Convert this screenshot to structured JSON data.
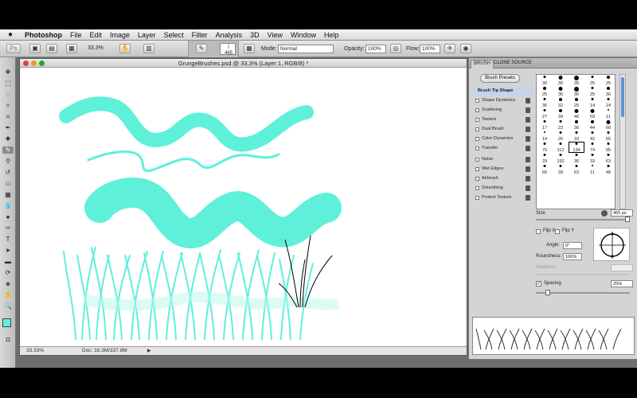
{
  "menubar": {
    "items": [
      "Photoshop",
      "File",
      "Edit",
      "Image",
      "Layer",
      "Select",
      "Filter",
      "Analysis",
      "3D",
      "View",
      "Window",
      "Help"
    ]
  },
  "optbar": {
    "zoom": "33.3%",
    "brush_size": "465",
    "mode_label": "Mode:",
    "mode_value": "Normal",
    "opacity_label": "Opacity:",
    "opacity_value": "100%",
    "flow_label": "Flow:",
    "flow_value": "100%"
  },
  "document": {
    "title": "GrungeBrushes.psd @ 33.3% (Layer 1, RGB/8) *",
    "status_zoom": "33.33%",
    "status_doc": "Doc: 16.3M/337.8M",
    "stroke_color": "#5ff0da"
  },
  "panel": {
    "tabs": [
      "BRUSH",
      "CLONE SOURCE"
    ],
    "preset_button": "Brush Presets",
    "options": [
      {
        "label": "Brush Tip Shape",
        "active": true
      },
      {
        "label": "Shape Dynamics"
      },
      {
        "label": "Scattering"
      },
      {
        "label": "Texture"
      },
      {
        "label": "Dual Brush"
      },
      {
        "label": "Color Dynamics"
      },
      {
        "label": "Transfer"
      },
      {
        "label": "Noise"
      },
      {
        "label": "Wet Edges"
      },
      {
        "label": "Airbrush"
      },
      {
        "label": "Smoothing"
      },
      {
        "label": "Protect Texture"
      }
    ],
    "tips": [
      {
        "n": "30",
        "s": 3
      },
      {
        "n": "30",
        "s": 5
      },
      {
        "n": "30",
        "s": 6
      },
      {
        "n": "25",
        "s": 3
      },
      {
        "n": "25",
        "s": 4
      },
      {
        "n": "25",
        "s": 4
      },
      {
        "n": "36",
        "s": 5
      },
      {
        "n": "36",
        "s": 6
      },
      {
        "n": "25",
        "s": 3
      },
      {
        "n": "36",
        "s": 4
      },
      {
        "n": "36",
        "s": 3
      },
      {
        "n": "32",
        "s": 4
      },
      {
        "n": "25",
        "s": 4
      },
      {
        "n": "14",
        "s": 3
      },
      {
        "n": "24",
        "s": 3
      },
      {
        "n": "27",
        "s": 3
      },
      {
        "n": "39",
        "s": 4
      },
      {
        "n": "46",
        "s": 5
      },
      {
        "n": "59",
        "s": 5
      },
      {
        "n": "11",
        "s": 2
      },
      {
        "n": "17",
        "s": 3
      },
      {
        "n": "23",
        "s": 3
      },
      {
        "n": "36",
        "s": 4
      },
      {
        "n": "44",
        "s": 4
      },
      {
        "n": "60",
        "s": 5
      },
      {
        "n": "14",
        "s": 2
      },
      {
        "n": "26",
        "s": 3
      },
      {
        "n": "33",
        "s": 3
      },
      {
        "n": "42",
        "s": 3
      },
      {
        "n": "55",
        "s": 3
      },
      {
        "n": "70",
        "s": 3
      },
      {
        "n": "112",
        "s": 3
      },
      {
        "n": "134",
        "s": 3
      },
      {
        "n": "74",
        "s": 3
      },
      {
        "n": "95",
        "s": 3
      },
      {
        "n": "29",
        "s": 3
      },
      {
        "n": "192",
        "s": 3
      },
      {
        "n": "36",
        "s": 3
      },
      {
        "n": "33",
        "s": 3
      },
      {
        "n": "63",
        "s": 3
      },
      {
        "n": "66",
        "s": 3
      },
      {
        "n": "39",
        "s": 3
      },
      {
        "n": "63",
        "s": 3
      },
      {
        "n": "11",
        "s": 2
      },
      {
        "n": "48",
        "s": 3
      }
    ],
    "size_label": "Size",
    "size_value": "465 px",
    "flip_x": "Flip X",
    "flip_y": "Flip Y",
    "angle_label": "Angle:",
    "angle_value": "0°",
    "roundness_label": "Roundness:",
    "roundness_value": "100%",
    "hardness_label": "Hardness",
    "spacing_label": "Spacing",
    "spacing_value": "25%"
  }
}
